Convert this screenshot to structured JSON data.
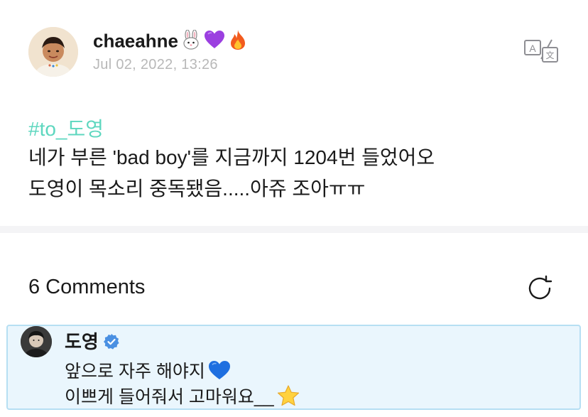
{
  "post": {
    "author": "chaeahne",
    "author_emojis": [
      "rabbit-face-icon",
      "purple-heart-icon",
      "fire-icon"
    ],
    "timestamp": "Jul 02, 2022, 13:26",
    "hashtag": "#to_도영",
    "lines": [
      "네가 부른 'bad boy'를 지금까지 1204번 들었어오",
      "도영이 목소리 중독됐음.....아쥬 조아ㅠㅠ"
    ]
  },
  "comments": {
    "count_label": "6 Comments",
    "items": [
      {
        "author": "도영",
        "verified": true,
        "lines": [
          "앞으로 자주 해야지",
          "이쁘게 들어줘서 고마워요__"
        ],
        "line_emojis": [
          "blue-heart-icon",
          "star-icon"
        ]
      }
    ]
  },
  "colors": {
    "hashtag": "#5ed7bf",
    "timestamp": "#b8b8b8",
    "comment_bg": "#eaf6fd",
    "comment_border": "#b6dff3",
    "verified": "#4a90e2",
    "divider": "#f4f4f6"
  }
}
